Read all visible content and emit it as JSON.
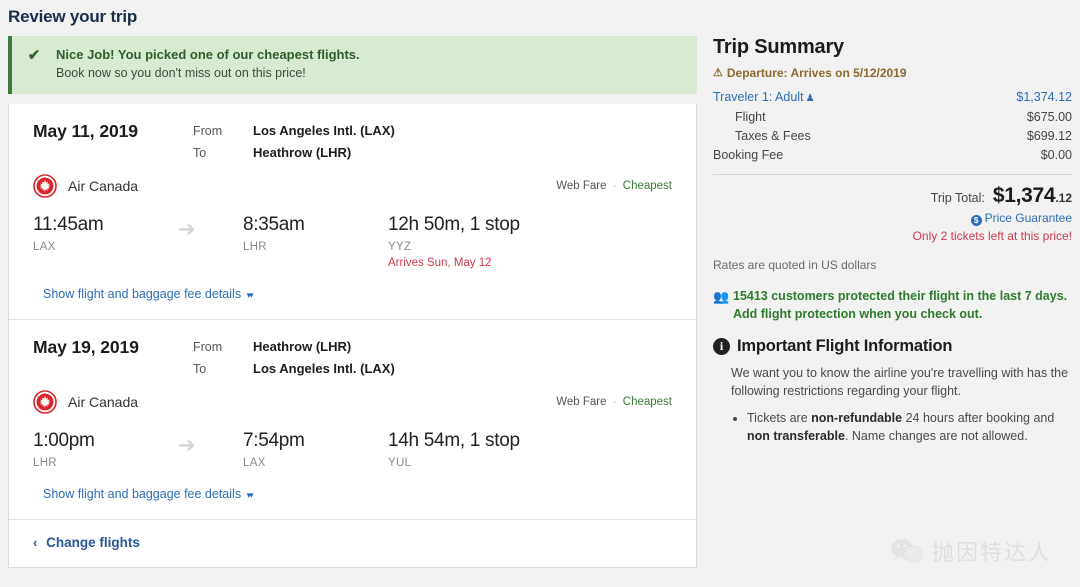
{
  "page": {
    "title": "Review your trip",
    "bg_color": "#f2f2f2"
  },
  "banner": {
    "check_icon": "check-icon",
    "title": "Nice Job! You picked one of our cheapest flights.",
    "subtitle": "Book now so you don't miss out on this price!",
    "bg_color": "#d9ead3",
    "border_color": "#3d7c3d"
  },
  "itinerary": {
    "segments": [
      {
        "date": "May 11, 2019",
        "from_label": "From",
        "to_label": "To",
        "from_value": "Los Angeles Intl. (LAX)",
        "to_value": "Heathrow (LHR)",
        "airline": "Air Canada",
        "airline_logo": "air-canada-logo",
        "fare_type": "Web Fare",
        "fare_separator": "·",
        "fare_badge": "Cheapest",
        "depart_time": "11:45am",
        "depart_code": "LAX",
        "arrow_icon": "arrow-right-icon",
        "arrive_time": "8:35am",
        "arrive_code": "LHR",
        "duration": "12h 50m, 1 stop",
        "stop_code": "YYZ",
        "arrives_note": "Arrives Sun, May 12",
        "details_link": "Show flight and baggage fee details",
        "details_chevron": "chevron-double-down-icon"
      },
      {
        "date": "May 19, 2019",
        "from_label": "From",
        "to_label": "To",
        "from_value": "Heathrow (LHR)",
        "to_value": "Los Angeles Intl. (LAX)",
        "airline": "Air Canada",
        "airline_logo": "air-canada-logo",
        "fare_type": "Web Fare",
        "fare_separator": "·",
        "fare_badge": "Cheapest",
        "depart_time": "1:00pm",
        "depart_code": "LHR",
        "arrow_icon": "arrow-right-icon",
        "arrive_time": "7:54pm",
        "arrive_code": "LAX",
        "duration": "14h 54m, 1 stop",
        "stop_code": "YUL",
        "arrives_note": "",
        "details_link": "Show flight and baggage fee details",
        "details_chevron": "chevron-double-down-icon"
      }
    ],
    "change_flights": "Change flights",
    "change_flights_chevron": "‹"
  },
  "summary": {
    "title": "Trip Summary",
    "departure_warning": "Departure: Arrives on 5/12/2019",
    "warning_icon": "warning-triangle-icon",
    "warning_color": "#8a6b2f",
    "rows": [
      {
        "label": "Traveler 1: Adult",
        "amount": "$1,374.12",
        "kind": "traveler",
        "person_icon": "person-icon"
      },
      {
        "label": "Flight",
        "amount": "$675.00",
        "kind": "indent"
      },
      {
        "label": "Taxes & Fees",
        "amount": "$699.12",
        "kind": "indent"
      },
      {
        "label": "Booking Fee",
        "amount": "$0.00",
        "kind": "normal"
      }
    ],
    "total_label": "Trip Total:",
    "total_dollars": "$1,374",
    "total_cents": ".12",
    "price_guarantee": "Price Guarantee",
    "price_guarantee_icon": "dollar-coin-icon",
    "tickets_left": "Only 2 tickets left at this price!",
    "tickets_left_color": "#d0394a",
    "rates_note": "Rates are quoted in US dollars",
    "protection_icon": "people-protected-icon",
    "protection_text": "15413 customers protected their flight in the last 7 days. Add flight protection when you check out.",
    "protection_color": "#2f7a2f",
    "info_icon": "info-circle-icon",
    "info_title": "Important Flight Information",
    "info_body": "We want you to know the airline you're travelling with has the following restrictions regarding your flight.",
    "info_bullets": [
      {
        "pre": "Tickets are ",
        "bold1": "non-refundable",
        "mid": " 24 hours after booking and ",
        "bold2": "non transferable",
        "post": ". Name changes are not allowed."
      }
    ]
  },
  "watermark": {
    "icon": "wechat-icon",
    "text": "抛因特达人"
  }
}
